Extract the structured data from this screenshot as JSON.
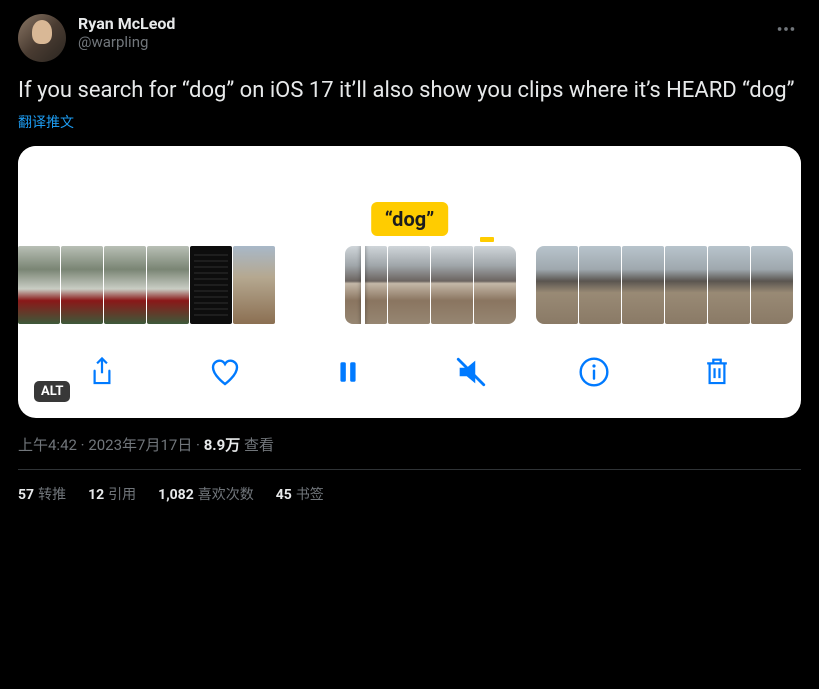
{
  "author": {
    "display_name": "Ryan McLeod",
    "handle": "@warpling"
  },
  "body": "If you search for “dog” on iOS 17 it’ll also show you clips where it’s HEARD “dog”",
  "translate_label": "翻译推文",
  "media": {
    "caption_tag": "“dog”",
    "alt_badge": "ALT",
    "toolbar": {
      "share": "share-icon",
      "like": "heart-icon",
      "pause": "pause-icon",
      "mute": "mute-icon",
      "info": "info-icon",
      "delete": "trash-icon"
    }
  },
  "meta": {
    "time": "上午4:42",
    "sep1": " · ",
    "date": "2023年7月17日",
    "sep2": " · ",
    "views_count": "8.9万",
    "views_label": " 查看"
  },
  "stats": {
    "retweets": {
      "count": "57",
      "label": "转推"
    },
    "quotes": {
      "count": "12",
      "label": "引用"
    },
    "likes": {
      "count": "1,082",
      "label": "喜欢次数"
    },
    "bookmarks": {
      "count": "45",
      "label": "书签"
    }
  }
}
